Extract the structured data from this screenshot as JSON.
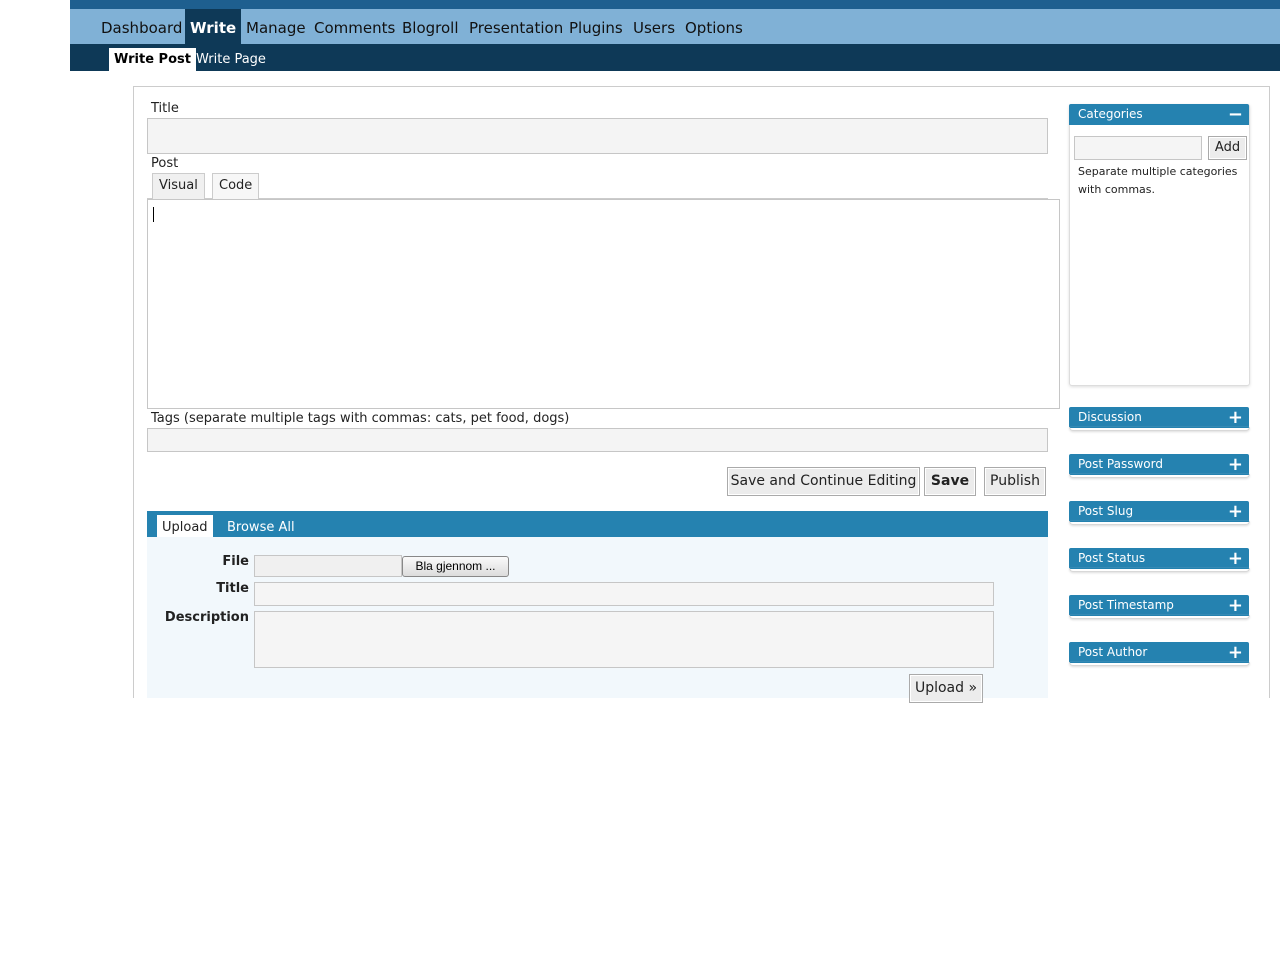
{
  "menu": {
    "items": [
      {
        "label": "Dashboard"
      },
      {
        "label": "Write"
      },
      {
        "label": "Manage"
      },
      {
        "label": "Comments"
      },
      {
        "label": "Blogroll"
      },
      {
        "label": "Presentation"
      },
      {
        "label": "Plugins"
      },
      {
        "label": "Users"
      },
      {
        "label": "Options"
      }
    ],
    "active": "Write"
  },
  "submenu": {
    "items": [
      {
        "label": "Write Post"
      },
      {
        "label": "Write Page"
      }
    ],
    "active": "Write Post"
  },
  "form": {
    "title_label": "Title",
    "title_value": "",
    "post_label": "Post",
    "editor_tabs": [
      "Visual",
      "Code"
    ],
    "tags_label": "Tags (separate multiple tags with commas: cats, pet food, dogs)",
    "tags_value": ""
  },
  "actions": {
    "save_continue": "Save and Continue Editing",
    "save": "Save",
    "publish": "Publish"
  },
  "uploader": {
    "tabs": [
      "Upload",
      "Browse All"
    ],
    "active_tab": "Upload",
    "file_label": "File",
    "browse_button": "Bla gjennom ...",
    "title_label": "Title",
    "description_label": "Description",
    "upload_button": "Upload »"
  },
  "sidebar": {
    "categories": {
      "title": "Categories",
      "toggle": "−",
      "add_button": "Add",
      "hint": "Separate multiple categories with commas."
    },
    "boxes": [
      {
        "title": "Discussion",
        "toggle": "+"
      },
      {
        "title": "Post Password",
        "toggle": "+"
      },
      {
        "title": "Post Slug",
        "toggle": "+"
      },
      {
        "title": "Post Status",
        "toggle": "+"
      },
      {
        "title": "Post Timestamp",
        "toggle": "+"
      },
      {
        "title": "Post Author",
        "toggle": "+"
      }
    ]
  },
  "colors": {
    "menu_bg": "#80b1d6",
    "menu_active": "#0e3957",
    "accent": "#2582b0"
  }
}
